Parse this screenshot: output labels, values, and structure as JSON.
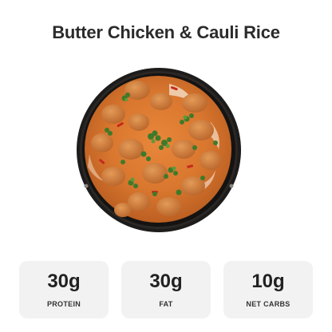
{
  "recipe": {
    "title": "Butter Chicken & Cauli Rice"
  },
  "image": {
    "icon": "food-photo"
  },
  "stats": [
    {
      "value": "30g",
      "label": "PROTEIN"
    },
    {
      "value": "30g",
      "label": "FAT"
    },
    {
      "value": "10g",
      "label": "NET CARBS"
    }
  ],
  "colors": {
    "title": "#2b2b2b",
    "card_background": "#f2f2f2",
    "sauce": "#d9772f",
    "pan": "#1e1c1b"
  }
}
